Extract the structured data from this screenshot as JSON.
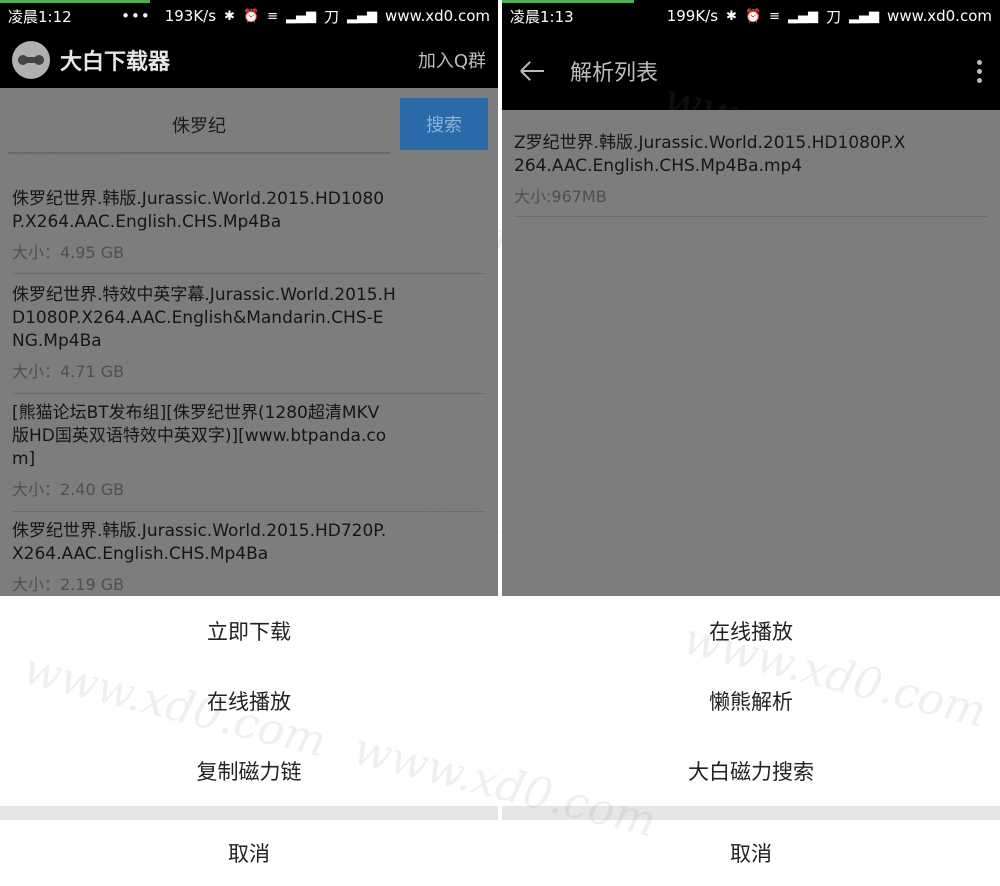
{
  "left_phone": {
    "status_bar": {
      "time": "凌晨1:12",
      "dots": "•••",
      "speed": "193K/s",
      "carrier": "刀",
      "site": "www.xd0.com"
    },
    "app_bar": {
      "title": "大白下载器",
      "join_group": "加入Q群"
    },
    "search": {
      "query": "侏罗纪",
      "button": "搜索"
    },
    "results": [
      {
        "title": "侏罗纪世界.韩版.Jurassic.World.2015.HD1080P.X264.AAC.English.CHS.Mp4Ba",
        "size": "大小：4.95 GB"
      },
      {
        "title": "侏罗纪世界.特效中英字幕.Jurassic.World.2015.HD1080P.X264.AAC.English&Mandarin.CHS-ENG.Mp4Ba",
        "size": "大小：4.71 GB"
      },
      {
        "title": "[熊猫论坛BT发布组][侏罗纪世界(1280超清MKV版HD国英双语特效中英双字)][www.btpanda.com]",
        "size": "大小：2.40 GB"
      },
      {
        "title": "侏罗纪世界.韩版.Jurassic.World.2015.HD720P.X264.AAC.English.CHS.Mp4Ba",
        "size": "大小：2.19 GB"
      }
    ],
    "sheet": {
      "items": [
        "立即下载",
        "在线播放",
        "复制磁力链"
      ],
      "cancel": "取消"
    }
  },
  "right_phone": {
    "status_bar": {
      "time": "凌晨1:13",
      "speed": "199K/s",
      "carrier": "刀",
      "site": "www.xd0.com"
    },
    "app_bar": {
      "title": "解析列表"
    },
    "files": [
      {
        "title": "Z罗纪世界.韩版.Jurassic.World.2015.HD1080P.X264.AAC.English.CHS.Mp4Ba.mp4",
        "size": "大小:967MB"
      }
    ],
    "sheet": {
      "items": [
        "在线播放",
        "懒熊解析",
        "大白磁力搜索"
      ],
      "cancel": "取消"
    }
  },
  "colors": {
    "status_accent": "#4caf50",
    "search_button": "#2b6aa8",
    "dim_overlay": "#7d7d7d"
  },
  "watermark": "www.xd0.com"
}
